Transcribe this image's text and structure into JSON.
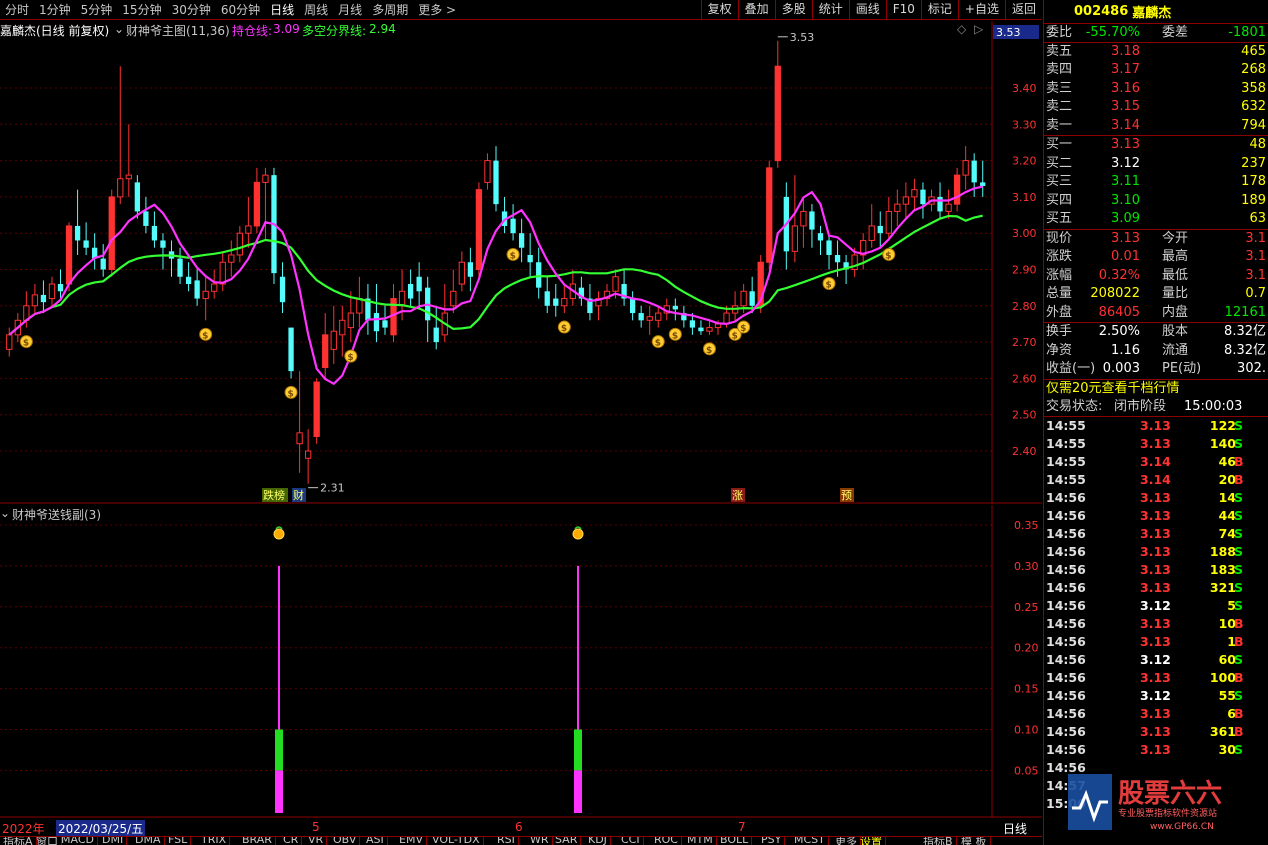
{
  "toolbar": {
    "periods": [
      "分时",
      "1分钟",
      "5分钟",
      "15分钟",
      "30分钟",
      "60分钟",
      "日线",
      "周线",
      "月线",
      "多周期",
      "更多 >"
    ],
    "active_period": "日线",
    "tools": [
      "复权",
      "叠加",
      "多股",
      "统计",
      "画线",
      "F10",
      "标记",
      "+自选",
      "返回"
    ]
  },
  "main_chart": {
    "stock_label": "嘉麟杰(日线 前复权)",
    "indicator_label": "财神爷主图(11,36)",
    "line1_label": "持仓线:",
    "line1_value": "3.09",
    "line2_label": "多空分界线:",
    "line2_value": "2.94",
    "current_price_tag": "3.53",
    "price_ticks": [
      "3.40",
      "3.30",
      "3.20",
      "3.10",
      "3.00",
      "2.90",
      "2.80",
      "2.70",
      "2.60",
      "2.50",
      "2.40"
    ],
    "high_label": "3.53",
    "low_label": "2.31",
    "tags": [
      "跌榜",
      "财",
      "涨",
      "预"
    ]
  },
  "sub_chart": {
    "title": "财神爷送钱副(3)",
    "ticks": [
      "0.35",
      "0.30",
      "0.25",
      "0.20",
      "0.15",
      "0.10",
      "0.05"
    ]
  },
  "time_axis": {
    "year": "2022年",
    "date": "2022/03/25/五",
    "months": [
      "5",
      "6",
      "7"
    ],
    "period": "日线"
  },
  "tab_bar": {
    "tabs": [
      "指标A",
      "窗口",
      "MACD",
      "DMI",
      "DMA",
      "FSL",
      "TRIX",
      "BRAR",
      "CR",
      "VR",
      "OBV",
      "ASI",
      "EMV",
      "VOL-TDX",
      "RSI",
      "WR",
      "SAR",
      "KDJ",
      "CCI",
      "ROC",
      "MTM",
      "BOLL",
      "PSY",
      "MCST",
      "更多",
      "设置",
      "指标B",
      "模 板"
    ]
  },
  "quote": {
    "code": "002486",
    "name": "嘉麟杰",
    "weibi_label": "委比",
    "weibi": "-55.70%",
    "weicha_label": "委差",
    "weicha": "-1801",
    "sell": [
      {
        "label": "卖五",
        "price": "3.18",
        "vol": "465"
      },
      {
        "label": "卖四",
        "price": "3.17",
        "vol": "268"
      },
      {
        "label": "卖三",
        "price": "3.16",
        "vol": "358"
      },
      {
        "label": "卖二",
        "price": "3.15",
        "vol": "632"
      },
      {
        "label": "卖一",
        "price": "3.14",
        "vol": "794"
      }
    ],
    "buy": [
      {
        "label": "买一",
        "price": "3.13",
        "vol": "48"
      },
      {
        "label": "买二",
        "price": "3.12",
        "vol": "237"
      },
      {
        "label": "买三",
        "price": "3.11",
        "vol": "178"
      },
      {
        "label": "买四",
        "price": "3.10",
        "vol": "189"
      },
      {
        "label": "买五",
        "price": "3.09",
        "vol": "63"
      }
    ],
    "stats": [
      {
        "l1": "现价",
        "v1": "3.13",
        "l2": "今开",
        "v2": "3.1"
      },
      {
        "l1": "涨跌",
        "v1": "0.01",
        "l2": "最高",
        "v2": "3.1"
      },
      {
        "l1": "涨幅",
        "v1": "0.32%",
        "l2": "最低",
        "v2": "3.1"
      },
      {
        "l1": "总量",
        "v1": "208022",
        "l2": "量比",
        "v2": "0.7"
      },
      {
        "l1": "外盘",
        "v1": "86405",
        "l2": "内盘",
        "v2": "12161"
      }
    ],
    "stats2": [
      {
        "l1": "换手",
        "v1": "2.50%",
        "l2": "股本",
        "v2": "8.32亿"
      },
      {
        "l1": "净资",
        "v1": "1.16",
        "l2": "流通",
        "v2": "8.32亿"
      },
      {
        "l1": "收益(一)",
        "v1": "0.003",
        "l2": "PE(动)",
        "v2": "302."
      }
    ],
    "promo": "仅需20元查看千档行情",
    "trade_status_label": "交易状态:",
    "trade_status": "闭市阶段",
    "trade_time": "15:00:03",
    "ticks": [
      {
        "t": "14:55",
        "p": "3.13",
        "q": "122",
        "d": "S"
      },
      {
        "t": "14:55",
        "p": "3.13",
        "q": "140",
        "d": "S"
      },
      {
        "t": "14:55",
        "p": "3.14",
        "q": "46",
        "d": "B"
      },
      {
        "t": "14:55",
        "p": "3.14",
        "q": "20",
        "d": "B"
      },
      {
        "t": "14:56",
        "p": "3.13",
        "q": "14",
        "d": "S"
      },
      {
        "t": "14:56",
        "p": "3.13",
        "q": "44",
        "d": "S"
      },
      {
        "t": "14:56",
        "p": "3.13",
        "q": "74",
        "d": "S"
      },
      {
        "t": "14:56",
        "p": "3.13",
        "q": "188",
        "d": "S"
      },
      {
        "t": "14:56",
        "p": "3.13",
        "q": "183",
        "d": "S"
      },
      {
        "t": "14:56",
        "p": "3.13",
        "q": "321",
        "d": "S"
      },
      {
        "t": "14:56",
        "p": "3.12",
        "q": "5",
        "d": "S"
      },
      {
        "t": "14:56",
        "p": "3.13",
        "q": "10",
        "d": "B"
      },
      {
        "t": "14:56",
        "p": "3.13",
        "q": "1",
        "d": "B"
      },
      {
        "t": "14:56",
        "p": "3.12",
        "q": "60",
        "d": "S"
      },
      {
        "t": "14:56",
        "p": "3.13",
        "q": "100",
        "d": "B"
      },
      {
        "t": "14:56",
        "p": "3.12",
        "q": "55",
        "d": "S"
      },
      {
        "t": "14:56",
        "p": "3.13",
        "q": "6",
        "d": "B"
      },
      {
        "t": "14:56",
        "p": "3.13",
        "q": "361",
        "d": "B"
      },
      {
        "t": "14:56",
        "p": "3.13",
        "q": "30",
        "d": "S"
      },
      {
        "t": "14:56",
        "p": "",
        "q": "",
        "d": ""
      },
      {
        "t": "14:57",
        "p": "",
        "q": "",
        "d": ""
      },
      {
        "t": "15:00",
        "p": "",
        "q": "",
        "d": ""
      }
    ]
  },
  "watermark": {
    "title": "股票六六",
    "subtitle": "专业股票指标软件资源站",
    "url": "www.GP66.CN"
  },
  "colors": {
    "up": "#ff3232",
    "down": "#54fcfc",
    "line1": "#ff33ff",
    "line2": "#33ff33",
    "grid": "#8b0000"
  }
}
